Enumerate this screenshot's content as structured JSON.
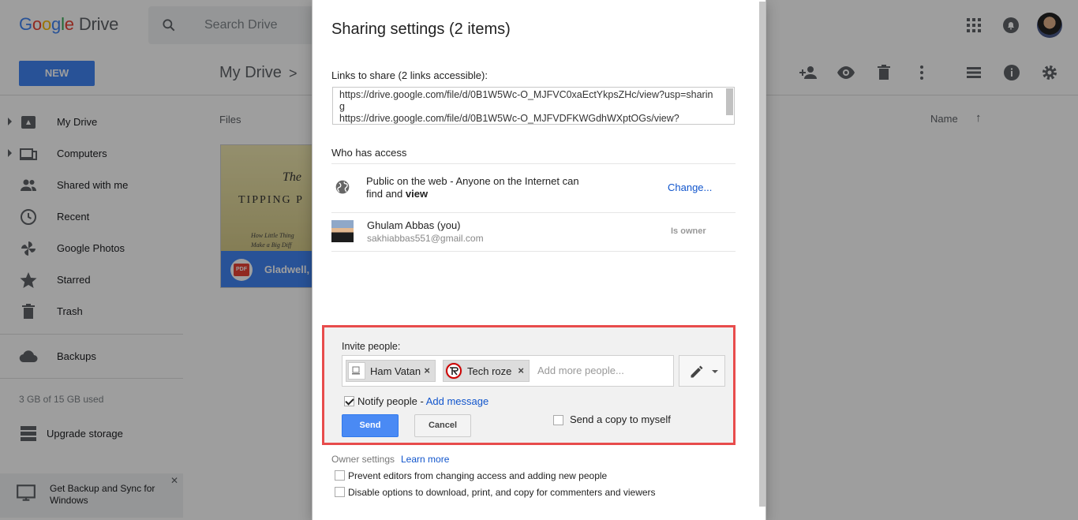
{
  "app": {
    "logo_brand": [
      "G",
      "o",
      "o",
      "g",
      "l",
      "e"
    ],
    "logo_product": "Drive",
    "search_placeholder": "Search Drive",
    "new_button": "NEW",
    "breadcrumb": "My Drive",
    "sidebar": [
      {
        "label": "My Drive",
        "icon": "drive-icon"
      },
      {
        "label": "Computers",
        "icon": "computers-icon"
      },
      {
        "label": "Shared with me",
        "icon": "people-icon"
      },
      {
        "label": "Recent",
        "icon": "clock-icon"
      },
      {
        "label": "Google Photos",
        "icon": "pinwheel-icon"
      },
      {
        "label": "Starred",
        "icon": "star-icon"
      },
      {
        "label": "Trash",
        "icon": "trash-icon"
      },
      {
        "label": "Backups",
        "icon": "cloud-icon"
      }
    ],
    "storage": "3 GB of 15 GB used",
    "upgrade_storage": "Upgrade storage",
    "backup_banner": "Get Backup and Sync for Windows",
    "files_label": "Files",
    "sort_label": "Name",
    "file": {
      "title_line1": "The",
      "title_line2": "TIPPING P",
      "subtitle_line1": "How Little Thing",
      "subtitle_line2": "Make a Big Diff",
      "badge": "PDF",
      "name": "Gladwell, M"
    }
  },
  "dialog": {
    "title": "Sharing settings (2 items)",
    "links_label": "Links to share (2 links accessible):",
    "links_text": "https://drive.google.com/file/d/0B1W5Wc-O_MJFVC0xaEctYkpsZHc/view?usp=sharing\nhttps://drive.google.com/file/d/0B1W5Wc-O_MJFVDFKWGdhWXptOGs/view?",
    "who_label": "Who has access",
    "public_text_1": "Public on the web - Anyone on the Internet can find and ",
    "public_text_bold": "view",
    "change_link": "Change...",
    "owner_name": "Ghulam Abbas (you)",
    "owner_email": "sakhiabbas551@gmail.com",
    "owner_role": "Is owner",
    "invite": {
      "label": "Invite people:",
      "chips": [
        {
          "name": "Ham Vatan",
          "remove": "×"
        },
        {
          "name": "Tech roze",
          "remove": "×"
        }
      ],
      "placeholder": "Add more people...",
      "notify_label": "Notify people - ",
      "add_message": "Add message",
      "notify_checked": true,
      "send": "Send",
      "cancel": "Cancel",
      "copy_self": "Send a copy to myself",
      "copy_checked": false
    },
    "owner_settings": "Owner settings",
    "learn_more": "Learn more",
    "options": [
      "Prevent editors from changing access and adding new people",
      "Disable options to download, print, and copy for commenters and viewers"
    ]
  },
  "colors": {
    "accent": "#4285f4",
    "link": "#1155cc",
    "highlight_border": "#e84c4c"
  }
}
